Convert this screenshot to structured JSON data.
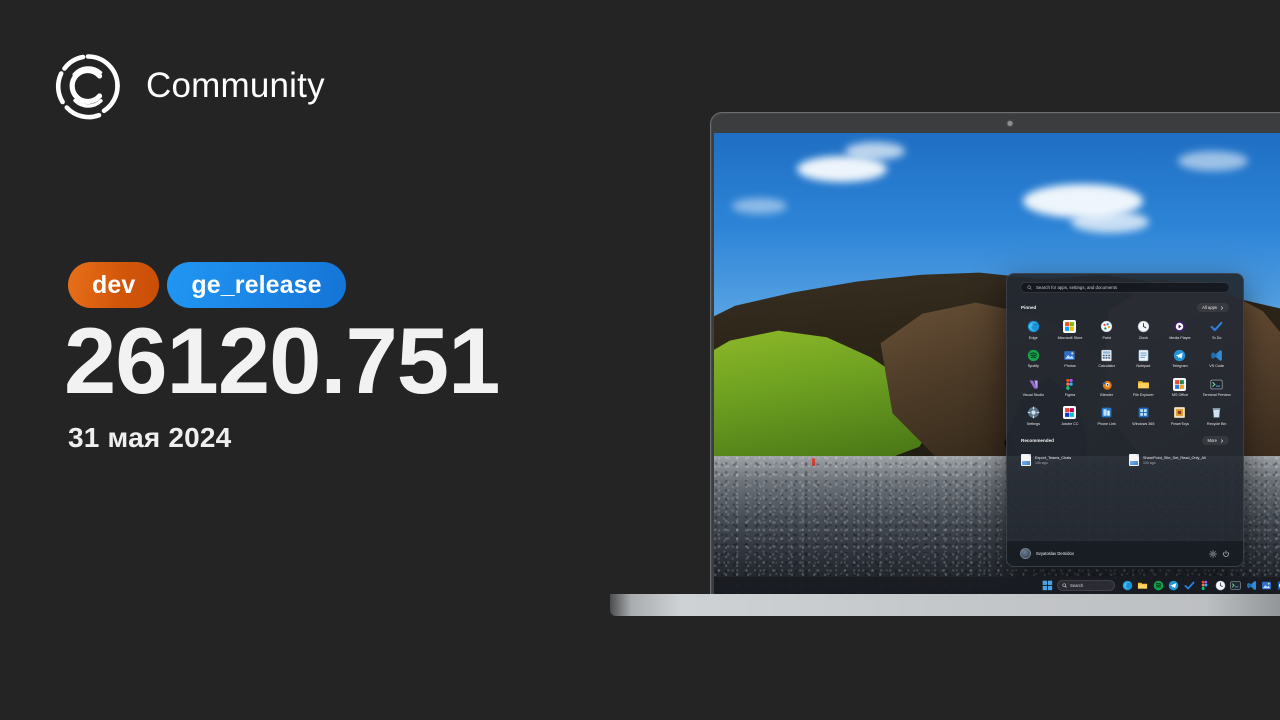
{
  "brand": {
    "name": "Community",
    "logo_icon": "community-c-logo"
  },
  "release": {
    "badges": [
      {
        "label": "dev",
        "color": "#d3570a"
      },
      {
        "label": "ge_release",
        "color": "#1b86e6"
      }
    ],
    "build_number": "26120.751",
    "date": "31 мая 2024"
  },
  "background_color": "#242424",
  "device": {
    "type": "laptop-mockup",
    "webcam_icon": "webcam-dot"
  },
  "wallpaper": {
    "description": "Iceland cliff with green moss and black pebble beach"
  },
  "start_menu": {
    "search": {
      "placeholder": "Search for apps, settings, and documents",
      "icon": "search-icon"
    },
    "pinned": {
      "title": "Pinned",
      "all_apps_label": "All apps",
      "all_apps_icon": "chevron-right-icon",
      "apps": [
        {
          "label": "Edge",
          "icon": "edge-icon"
        },
        {
          "label": "Microsoft Store",
          "icon": "microsoft-store-icon"
        },
        {
          "label": "Paint",
          "icon": "paint-icon"
        },
        {
          "label": "Clock",
          "icon": "clock-icon"
        },
        {
          "label": "Media Player",
          "icon": "media-player-icon"
        },
        {
          "label": "To Do",
          "icon": "to-do-icon"
        },
        {
          "label": "Spotify",
          "icon": "spotify-icon"
        },
        {
          "label": "Photos",
          "icon": "photos-icon"
        },
        {
          "label": "Calculator",
          "icon": "calculator-icon"
        },
        {
          "label": "Notepad",
          "icon": "notepad-icon"
        },
        {
          "label": "Telegram",
          "icon": "telegram-icon"
        },
        {
          "label": "VS Code",
          "icon": "vs-code-icon"
        },
        {
          "label": "Visual Studio",
          "icon": "visual-studio-icon"
        },
        {
          "label": "Figma",
          "icon": "figma-icon"
        },
        {
          "label": "Blender",
          "icon": "blender-icon"
        },
        {
          "label": "File Explorer",
          "icon": "file-explorer-icon"
        },
        {
          "label": "MS Office",
          "icon": "ms-office-icon"
        },
        {
          "label": "Terminal Preview",
          "icon": "terminal-preview-icon"
        },
        {
          "label": "Settings",
          "icon": "settings-icon"
        },
        {
          "label": "Adobe CC",
          "icon": "adobe-cc-icon"
        },
        {
          "label": "Phone Link",
          "icon": "phone-link-icon"
        },
        {
          "label": "Windows 365",
          "icon": "windows-365-icon"
        },
        {
          "label": "PowerToys",
          "icon": "powertoys-icon"
        },
        {
          "label": "Recycle Bin",
          "icon": "recycle-bin-icon"
        }
      ]
    },
    "recommended": {
      "title": "Recommended",
      "more_label": "More",
      "more_icon": "chevron-right-icon",
      "items": [
        {
          "name": "Export_Teams_Chats",
          "time": "14h ago",
          "icon": "document-icon"
        },
        {
          "name": "SharePoint_Site_Set_Read_Only_All",
          "time": "10h ago",
          "icon": "document-icon"
        }
      ]
    },
    "footer": {
      "user_name": "Svyatoslav Demidov",
      "avatar_icon": "user-avatar",
      "settings_icon": "gear-icon",
      "power_icon": "power-icon"
    }
  },
  "taskbar": {
    "start_icon": "windows-start-icon",
    "search": {
      "label": "Search",
      "icon": "search-icon"
    },
    "items": [
      {
        "icon": "edge-icon"
      },
      {
        "icon": "file-explorer-icon"
      },
      {
        "icon": "spotify-icon"
      },
      {
        "icon": "telegram-icon"
      },
      {
        "icon": "to-do-icon"
      },
      {
        "icon": "figma-icon"
      },
      {
        "icon": "clock-icon"
      },
      {
        "icon": "terminal-icon"
      },
      {
        "icon": "vs-code-icon"
      },
      {
        "icon": "photos-icon"
      },
      {
        "icon": "outlook-icon"
      },
      {
        "icon": "teams-icon"
      }
    ]
  }
}
